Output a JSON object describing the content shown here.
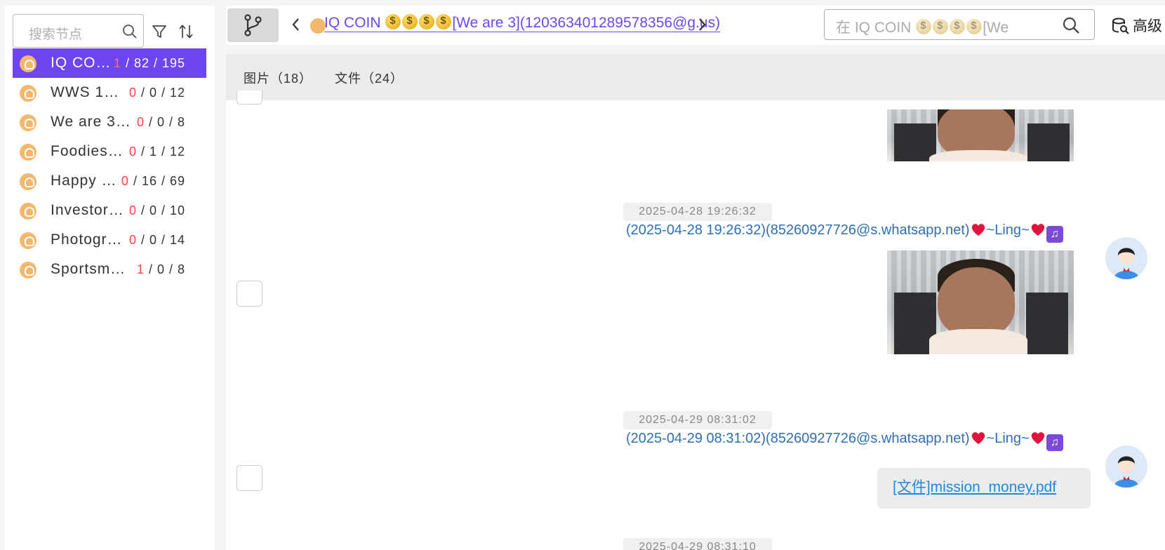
{
  "sidebar": {
    "search_placeholder": "搜索节点",
    "nodes": [
      {
        "name": "IQ CO…",
        "unread": "1",
        "rest": " / 82 / 195",
        "active": true
      },
      {
        "name": "WWS 1…",
        "unread": "0",
        "rest": " / 0 / 12"
      },
      {
        "name": "We are 3…",
        "unread": "0",
        "rest": " / 0 / 8"
      },
      {
        "name": "Foodies…",
        "unread": "0",
        "rest": " / 1 / 12"
      },
      {
        "name": "Happy …",
        "unread": "0",
        "rest": " / 16 / 69"
      },
      {
        "name": "Investor…",
        "unread": "0",
        "rest": " / 0 / 10"
      },
      {
        "name": "Photogr…",
        "unread": "0",
        "rest": " / 0 / 14"
      },
      {
        "name": "Sportsm…",
        "unread": "1",
        "rest": " / 0 / 8"
      }
    ]
  },
  "topbar": {
    "crumb_prefix": "IQ COIN ",
    "crumb_suffix": "[We are 3](120363401289578356@g.us)",
    "search_prefix": "在 IQ COIN ",
    "search_suffix": "[We",
    "advanced_label": "高级"
  },
  "tabs": {
    "images": "图片（18）",
    "files": "文件（24）"
  },
  "messages": [
    {
      "time": "2025-04-28 19:26:32",
      "sender_pre": "(2025-04-28 19:26:32)(85260927726@s.whatsapp.net)",
      "sender_name": "~Ling~"
    },
    {
      "time": "2025-04-29 08:31:02",
      "sender_pre": "(2025-04-29 08:31:02)(85260927726@s.whatsapp.net)",
      "sender_name": "~Ling~",
      "file": "[文件]mission_money.pdf"
    },
    {
      "time": "2025-04-29 08:31:10"
    }
  ],
  "colors": {
    "accent": "#6e46f0",
    "link": "#2f6fb6",
    "unread": "#ff4444"
  }
}
